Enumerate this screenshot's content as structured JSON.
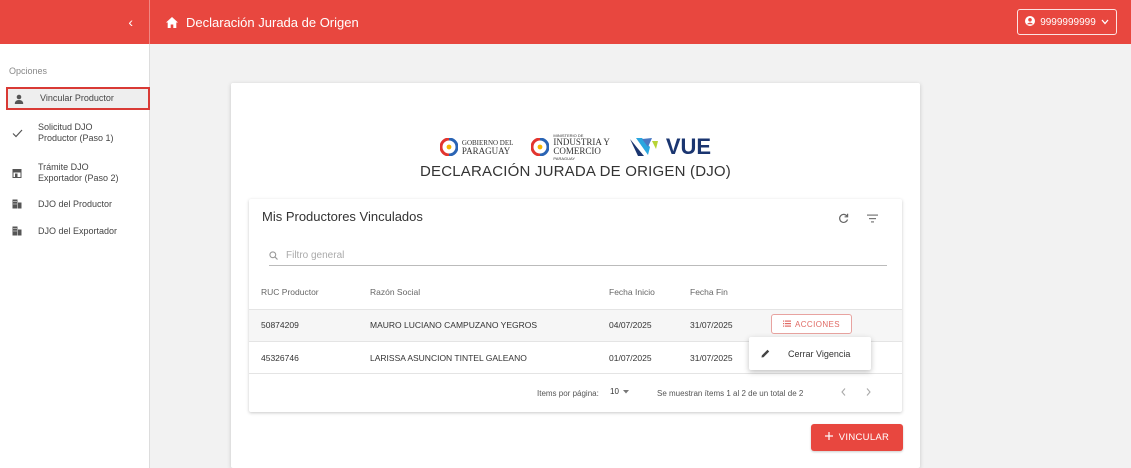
{
  "header": {
    "collapse_glyph": "‹",
    "title": "Declaración Jurada de Origen",
    "user": "9999999999",
    "accent": "#e8473f"
  },
  "sidebar": {
    "heading": "Opciones",
    "items": [
      {
        "icon": "person-icon",
        "label_lines": [
          "Vincular Productor"
        ],
        "active": true
      },
      {
        "icon": "check-icon",
        "label_lines": [
          "Solicitud DJO",
          "Productor (Paso 1)"
        ],
        "active": false
      },
      {
        "icon": "store-icon",
        "label_lines": [
          "Trámite DJO",
          "Exportador (Paso 2)"
        ],
        "active": false
      },
      {
        "icon": "building-icon",
        "label_lines": [
          "DJO del Productor"
        ],
        "active": false
      },
      {
        "icon": "building-icon",
        "label_lines": [
          "DJO del Exportador"
        ],
        "active": false
      }
    ]
  },
  "logos": {
    "gobierno": [
      "GOBIERNO DEL",
      "PARAGUAY"
    ],
    "ministerio_small": "MINISTERIO DE",
    "ministerio": [
      "INDUSTRIA Y",
      "COMERCIO"
    ],
    "ministerio_sub": "PARAGUAY",
    "vue": "VUE"
  },
  "main": {
    "title": "DECLARACIÓN JURADA DE ORIGEN (DJO)",
    "panel_title": "Mis Productores Vinculados",
    "search_placeholder": "Filtro general",
    "columns": [
      "RUC Productor",
      "Razón Social",
      "Fecha Inicio",
      "Fecha Fin"
    ],
    "rows": [
      {
        "ruc": "50874209",
        "razon": "MAURO LUCIANO CAMPUZANO YEGROS",
        "inicio": "04/07/2025",
        "fin": "31/07/2025"
      },
      {
        "ruc": "45326746",
        "razon": "LARISSA ASUNCION TINTEL GALEANO",
        "inicio": "01/07/2025",
        "fin": "31/07/2025"
      }
    ],
    "actions_label": "ACCIONES",
    "menu_item": "Cerrar Vigencia",
    "items_per_page_label": "Items por página:",
    "items_per_page_value": "10",
    "range_text": "Se muestran ítems 1 al 2 de un total de 2",
    "vincular_label": "VINCULAR"
  }
}
